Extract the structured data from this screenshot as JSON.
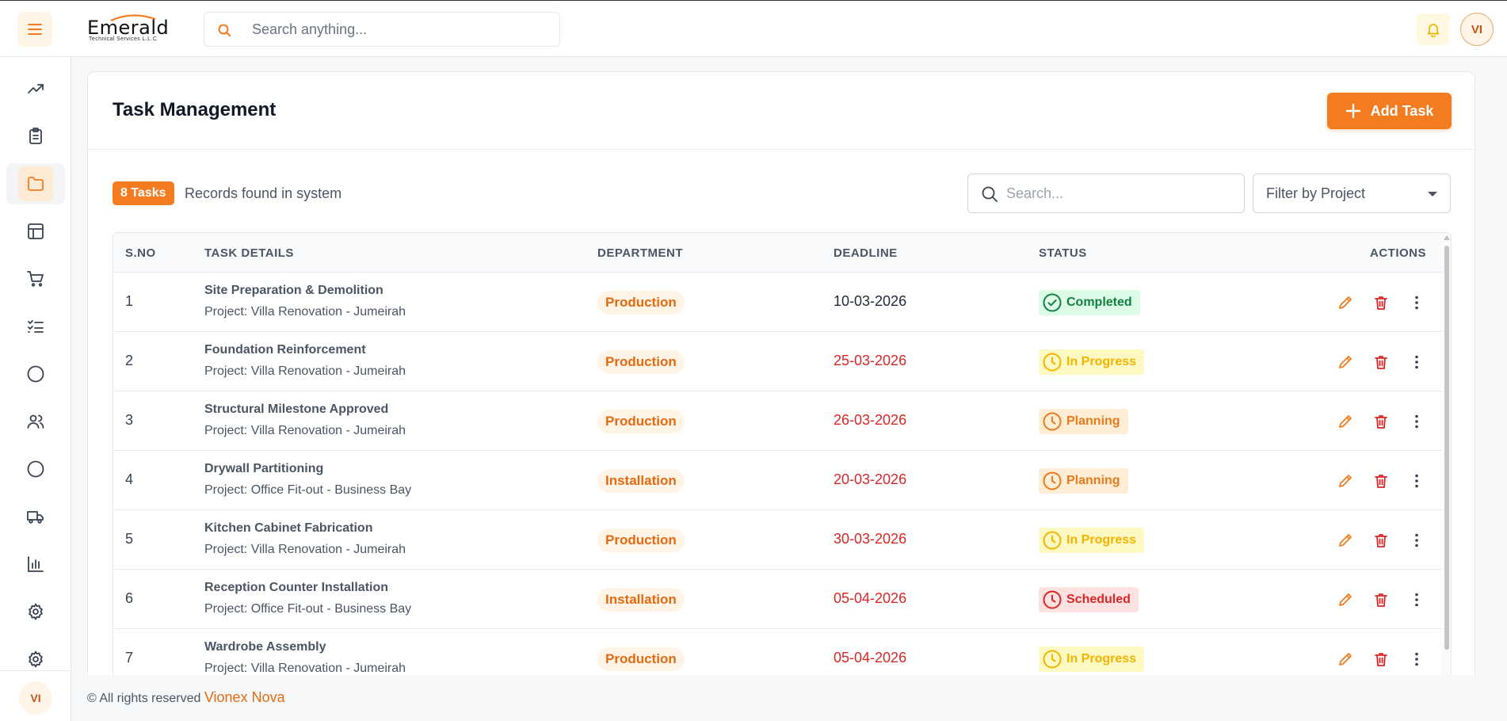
{
  "header": {
    "logo": {
      "main": "Emerald",
      "sub": "Technical Services L.L.C"
    },
    "search_placeholder": "Search anything...",
    "avatar_initials": "VI"
  },
  "sidebar": {
    "items": [
      {
        "icon": "trending-up-icon"
      },
      {
        "icon": "clipboard-icon"
      },
      {
        "icon": "folder-icon",
        "active": true
      },
      {
        "icon": "layout-icon"
      },
      {
        "icon": "cart-icon"
      },
      {
        "icon": "checklist-icon"
      },
      {
        "icon": "circle-icon"
      },
      {
        "icon": "users-icon"
      },
      {
        "icon": "circle-icon"
      },
      {
        "icon": "truck-icon"
      },
      {
        "icon": "bar-chart-icon"
      },
      {
        "icon": "gear-icon"
      },
      {
        "icon": "gear-icon"
      }
    ],
    "avatar_initials": "VI"
  },
  "page": {
    "title": "Task Management",
    "add_button": "Add Task",
    "count_badge": "8 Tasks",
    "count_text": "Records found in system",
    "search_placeholder": "Search...",
    "project_filter": "Filter by Project"
  },
  "table": {
    "headers": {
      "sno": "S.NO",
      "task": "TASK DETAILS",
      "department": "DEPARTMENT",
      "deadline": "DEADLINE",
      "status": "STATUS",
      "actions": "ACTIONS"
    },
    "rows": [
      {
        "no": "1",
        "task": "Site Preparation & Demolition",
        "project": "Project: Villa Renovation - Jumeirah",
        "department": "Production",
        "deadline": "10-03-2026",
        "overdue": false,
        "status": "Completed",
        "status_type": "completed"
      },
      {
        "no": "2",
        "task": "Foundation Reinforcement",
        "project": "Project: Villa Renovation - Jumeirah",
        "department": "Production",
        "deadline": "25-03-2026",
        "overdue": true,
        "status": "In Progress",
        "status_type": "progress"
      },
      {
        "no": "3",
        "task": "Structural Milestone Approved",
        "project": "Project: Villa Renovation - Jumeirah",
        "department": "Production",
        "deadline": "26-03-2026",
        "overdue": true,
        "status": "Planning",
        "status_type": "planning"
      },
      {
        "no": "4",
        "task": "Drywall Partitioning",
        "project": "Project: Office Fit-out - Business Bay",
        "department": "Installation",
        "deadline": "20-03-2026",
        "overdue": true,
        "status": "Planning",
        "status_type": "planning"
      },
      {
        "no": "5",
        "task": "Kitchen Cabinet Fabrication",
        "project": "Project: Villa Renovation - Jumeirah",
        "department": "Production",
        "deadline": "30-03-2026",
        "overdue": true,
        "status": "In Progress",
        "status_type": "progress"
      },
      {
        "no": "6",
        "task": "Reception Counter Installation",
        "project": "Project: Office Fit-out - Business Bay",
        "department": "Installation",
        "deadline": "05-04-2026",
        "overdue": true,
        "status": "Scheduled",
        "status_type": "scheduled"
      },
      {
        "no": "7",
        "task": "Wardrobe Assembly",
        "project": "Project: Villa Renovation - Jumeirah",
        "department": "Production",
        "deadline": "05-04-2026",
        "overdue": true,
        "status": "In Progress",
        "status_type": "progress"
      }
    ]
  },
  "footer": {
    "text": "© All rights reserved",
    "brand": "Vionex Nova"
  },
  "colors": {
    "accent": "#f47c20",
    "overdue": "#dc2626",
    "completed": "#15803d",
    "progress": "#f5b301",
    "planning": "#ea7a1d",
    "scheduled": "#dc2626"
  }
}
